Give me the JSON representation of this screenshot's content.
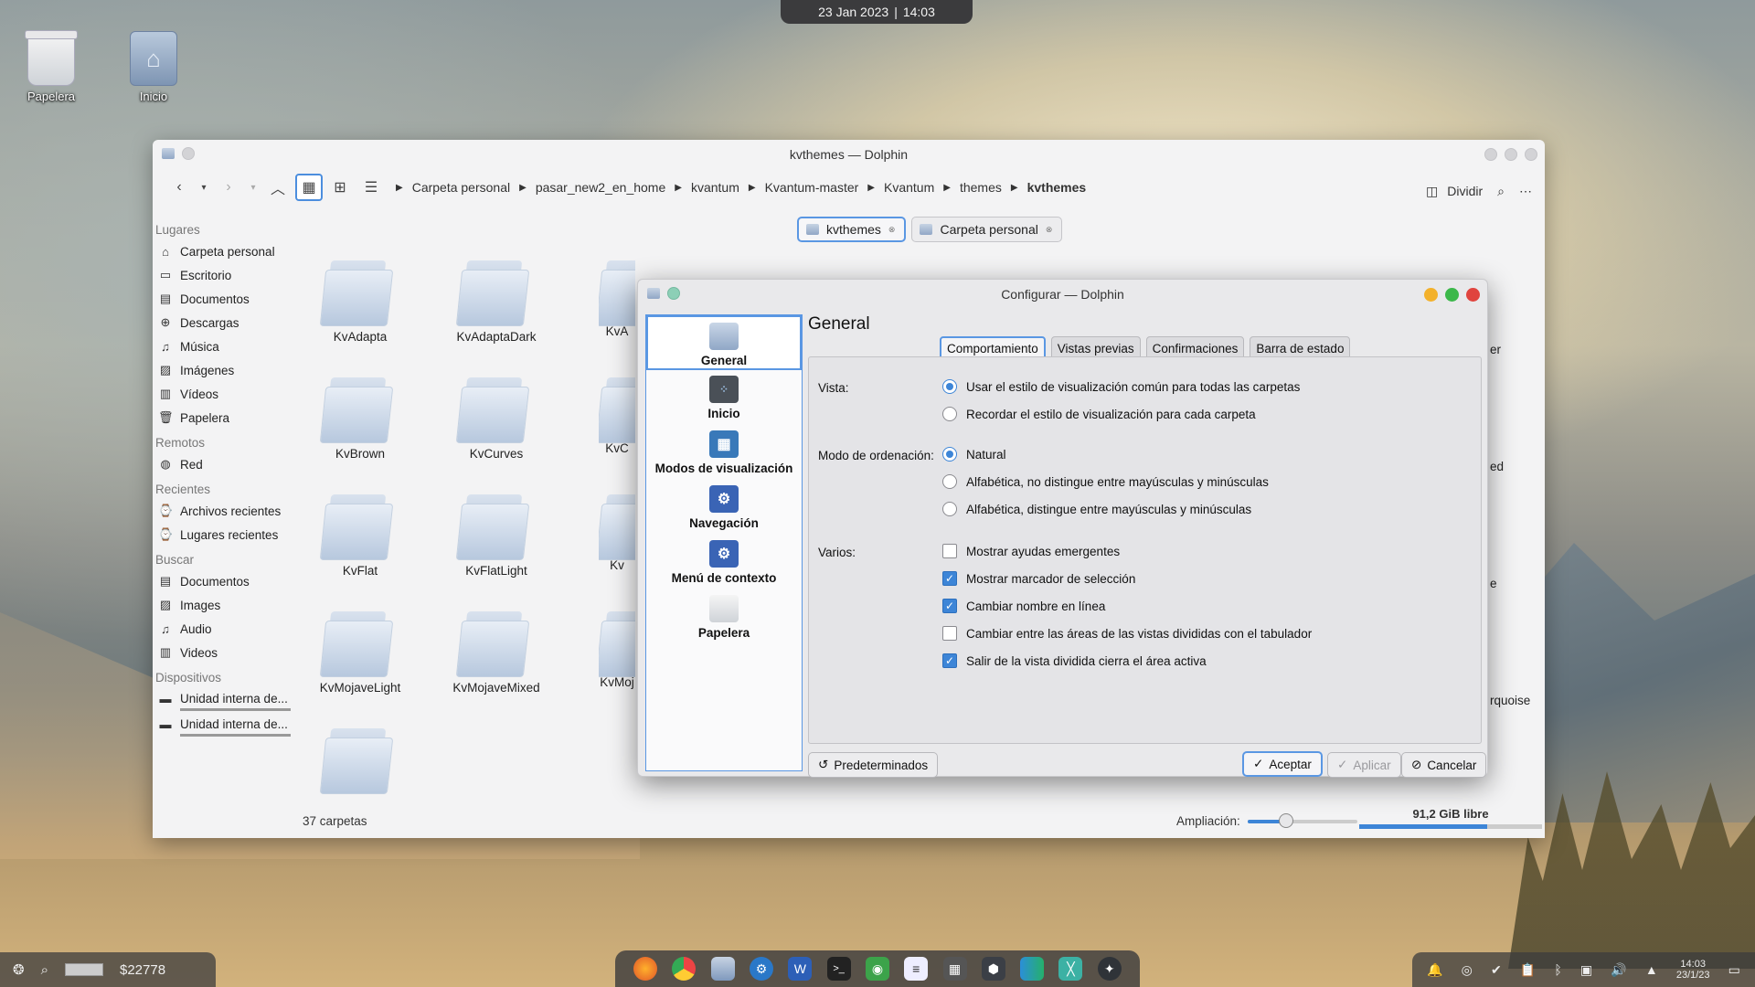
{
  "clock": {
    "date": "23 Jan 2023",
    "sep": "|",
    "time": "14:03"
  },
  "desktop_icons": [
    {
      "label": "Papelera",
      "icon": "trash-icon"
    },
    {
      "label": "Inicio",
      "icon": "home-folder-icon"
    }
  ],
  "dolphin": {
    "title": "kvthemes — Dolphin",
    "breadcrumb": [
      "Carpeta personal",
      "pasar_new2_en_home",
      "kvantum",
      "Kvantum-master",
      "Kvantum",
      "themes",
      "kvthemes"
    ],
    "split_label": "Dividir",
    "tabs": [
      "kvthemes",
      "Carpeta personal"
    ],
    "places": {
      "lugares_header": "Lugares",
      "lugares": [
        "Carpeta personal",
        "Escritorio",
        "Documentos",
        "Descargas",
        "Música",
        "Imágenes",
        "Vídeos",
        "Papelera"
      ],
      "remotos_header": "Remotos",
      "remotos": [
        "Red"
      ],
      "recientes_header": "Recientes",
      "recientes": [
        "Archivos recientes",
        "Lugares recientes"
      ],
      "buscar_header": "Buscar",
      "buscar": [
        "Documentos",
        "Images",
        "Audio",
        "Videos"
      ],
      "dispositivos_header": "Dispositivos",
      "dispositivos": [
        "Unidad interna de...",
        "Unidad interna de..."
      ]
    },
    "folders": [
      "KvAdapta",
      "KvAdaptaDark",
      "KvBrown",
      "KvCurves",
      "KvFlat",
      "KvFlatLight",
      "KvMojaveLight",
      "KvMojaveMixed"
    ],
    "partial_labels": [
      "KvA",
      "KvC",
      "Kv",
      "KvMoj",
      "er",
      "ed",
      "e",
      "rquoise"
    ],
    "status_count": "37 carpetas",
    "zoom_label": "Ampliación:",
    "zoom_level": 0.35,
    "free_space": "91,2 GiB libre",
    "free_used_fraction": 0.7
  },
  "dialog": {
    "title": "Configurar — Dolphin",
    "categories": [
      "General",
      "Inicio",
      "Modos de visualización",
      "Navegación",
      "Menú de contexto",
      "Papelera"
    ],
    "page_title": "General",
    "tabs": [
      "Comportamiento",
      "Vistas previas",
      "Confirmaciones",
      "Barra de estado"
    ],
    "vista_label": "Vista:",
    "vista_options": [
      "Usar el estilo de visualización común para todas las carpetas",
      "Recordar el estilo de visualización para cada carpeta"
    ],
    "orden_label": "Modo de ordenación:",
    "orden_options": [
      "Natural",
      "Alfabética, no distingue entre mayúsculas y minúsculas",
      "Alfabética, distingue entre mayúsculas y minúsculas"
    ],
    "varios_label": "Varios:",
    "varios_options": [
      {
        "label": "Mostrar ayudas emergentes",
        "checked": false
      },
      {
        "label": "Mostrar marcador de selección",
        "checked": true
      },
      {
        "label": "Cambiar nombre en línea",
        "checked": true
      },
      {
        "label": "Cambiar entre las áreas de las vistas divididas con el tabulador",
        "checked": false
      },
      {
        "label": "Salir de la vista dividida cierra el área activa",
        "checked": true
      }
    ],
    "defaults_button": "Predeterminados",
    "accept_button": "Aceptar",
    "apply_button": "Aplicar",
    "cancel_button": "Cancelar"
  },
  "taskbar": {
    "left_text": "$22778",
    "tray_time": "14:03",
    "tray_date": "23/1/23"
  },
  "colors": {
    "accent": "#3d85d7",
    "dialog_max": "#3cb84a",
    "dialog_min": "#f3b12b",
    "dialog_close": "#e0443e"
  }
}
